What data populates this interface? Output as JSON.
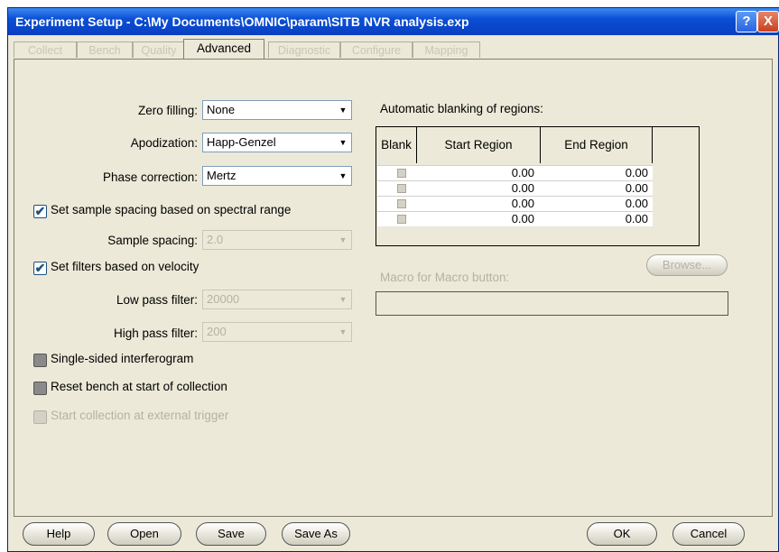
{
  "window": {
    "title": "Experiment Setup - C:\\My Documents\\OMNIC\\param\\SITB NVR analysis.exp",
    "help_glyph": "?",
    "close_glyph": "X"
  },
  "tabs": [
    {
      "label": "Collect"
    },
    {
      "label": "Bench"
    },
    {
      "label": "Quality"
    },
    {
      "label": "Advanced"
    },
    {
      "label": "Diagnostic"
    },
    {
      "label": "Configure"
    },
    {
      "label": "Mapping"
    }
  ],
  "active_tab": "Advanced",
  "form": {
    "zero_filling": {
      "label": "Zero filling:",
      "value": "None"
    },
    "apodization": {
      "label": "Apodization:",
      "value": "Happ-Genzel"
    },
    "phase_correction": {
      "label": "Phase correction:",
      "value": "Mertz"
    },
    "sample_spacing_check": {
      "label": "Set sample spacing based on spectral range",
      "checked": true
    },
    "sample_spacing": {
      "label": "Sample spacing:",
      "value": "2.0"
    },
    "filters_check": {
      "label": "Set filters based on velocity",
      "checked": true
    },
    "low_pass": {
      "label": "Low pass filter:",
      "value": "20000"
    },
    "high_pass": {
      "label": "High pass filter:",
      "value": "200"
    },
    "single_sided": {
      "label": "Single-sided interferogram",
      "checked": false
    },
    "reset_bench": {
      "label": "Reset bench at start of collection",
      "checked": false
    },
    "external_trigger": {
      "label": "Start collection at external trigger",
      "checked": false
    }
  },
  "blanking": {
    "title": "Automatic blanking of regions:",
    "columns": [
      "Blank",
      "Start Region",
      "End Region"
    ],
    "rows": [
      {
        "start": "0.00",
        "end": "0.00"
      },
      {
        "start": "0.00",
        "end": "0.00"
      },
      {
        "start": "0.00",
        "end": "0.00"
      },
      {
        "start": "0.00",
        "end": "0.00"
      }
    ]
  },
  "macro": {
    "label": "Macro for Macro button:",
    "browse_label": "Browse...",
    "value": ""
  },
  "buttons": {
    "help": "Help",
    "open": "Open",
    "save": "Save",
    "save_as": "Save As",
    "ok": "OK",
    "cancel": "Cancel"
  },
  "icons": {
    "combo_arrow": "▼",
    "check": "✔"
  }
}
